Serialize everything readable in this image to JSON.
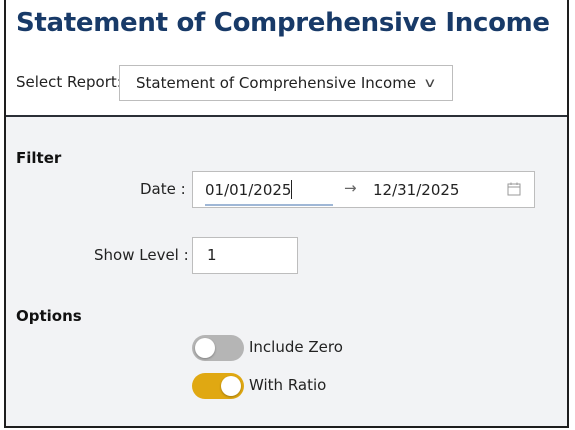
{
  "page": {
    "title": "Statement of Comprehensive Income",
    "select_report_label": "Select Report:",
    "select_report_value": "Statement of Comprehensive Income"
  },
  "filter": {
    "section_title": "Filter",
    "date_label": "Date :",
    "date_start": "01/01/2025",
    "date_arrow": "→",
    "date_end": "12/31/2025",
    "show_level_label": "Show Level :",
    "show_level_value": "1"
  },
  "options": {
    "section_title": "Options",
    "include_zero_label": "Include Zero",
    "include_zero_on": false,
    "with_ratio_label": "With Ratio",
    "with_ratio_on": true
  },
  "colors": {
    "title": "#183a68",
    "toggle_on": "#e0a812",
    "toggle_off": "#b5b5b5"
  }
}
